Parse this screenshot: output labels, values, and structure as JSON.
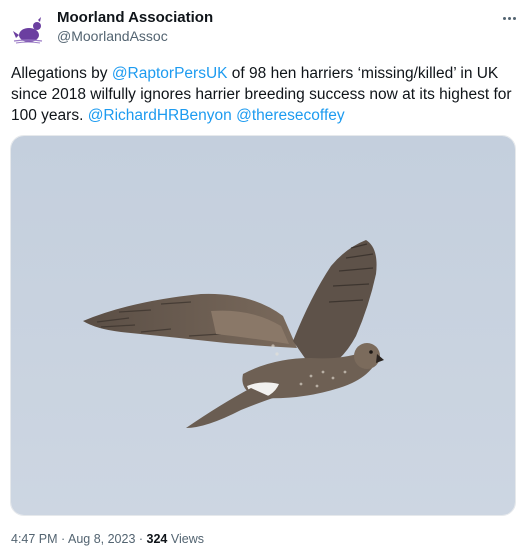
{
  "author": {
    "name": "Moorland Association",
    "handle": "@MoorlandAssoc",
    "avatar_icon": "grouse-logo-icon",
    "brand_color": "#6b3fa0"
  },
  "more_icon": "more-options-icon",
  "tweet": {
    "segments": [
      {
        "type": "text",
        "value": "Allegations by "
      },
      {
        "type": "mention",
        "value": "@RaptorPersUK"
      },
      {
        "type": "text",
        "value": " of 98 hen harriers ‘missing/killed’ in UK since 2018 wilfully ignores harrier breeding success now at its highest for 100 years. "
      },
      {
        "type": "mention",
        "value": "@RichardHRBenyon"
      },
      {
        "type": "text",
        "value": " "
      },
      {
        "type": "mention",
        "value": "@theresecoffey"
      }
    ],
    "mention_color": "#1d9bf0"
  },
  "media": {
    "subject": "hen-harrier-in-flight",
    "sky_color": "#c6d1df"
  },
  "meta": {
    "time": "4:47 PM",
    "separator": " · ",
    "date": "Aug 8, 2023",
    "views_count": "324",
    "views_label": " Views"
  }
}
